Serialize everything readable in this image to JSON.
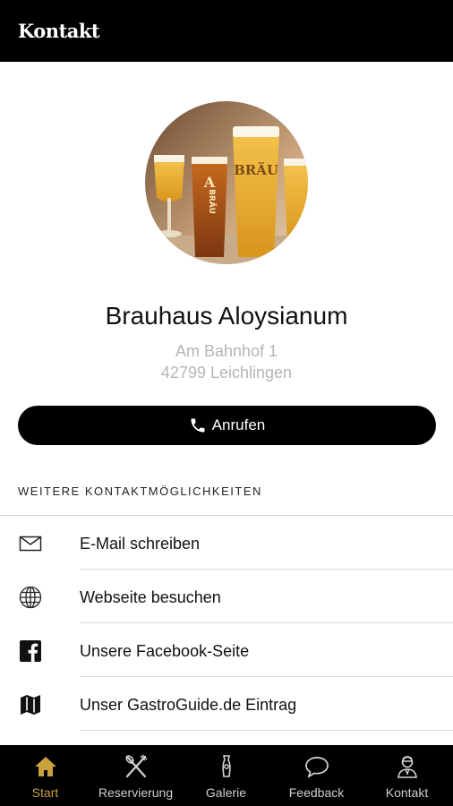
{
  "header": {
    "title": "Kontakt"
  },
  "venue": {
    "name": "Brauhaus Aloysianum",
    "address_line1": "Am Bahnhof 1",
    "address_line2": "42799 Leichlingen",
    "glass_brand": "BRÄU"
  },
  "call_button": {
    "label": "Anrufen",
    "icon": "phone-icon"
  },
  "contact_section": {
    "title": "WEITERE KONTAKTMÖGLICHKEITEN",
    "items": [
      {
        "label": "E-Mail schreiben",
        "icon": "mail-icon"
      },
      {
        "label": "Webseite besuchen",
        "icon": "globe-icon"
      },
      {
        "label": "Unsere Facebook-Seite",
        "icon": "facebook-icon"
      },
      {
        "label": "Unser GastroGuide.de Eintrag",
        "icon": "map-icon"
      }
    ]
  },
  "tabbar": {
    "active_color": "#c9a13b",
    "tabs": [
      {
        "label": "Start",
        "icon": "home-icon",
        "active": true
      },
      {
        "label": "Reservierung",
        "icon": "cutlery-icon",
        "active": false
      },
      {
        "label": "Galerie",
        "icon": "gallery-icon",
        "active": false
      },
      {
        "label": "Feedback",
        "icon": "speech-bubble-icon",
        "active": false
      },
      {
        "label": "Kontakt",
        "icon": "contact-person-icon",
        "active": false
      }
    ]
  }
}
